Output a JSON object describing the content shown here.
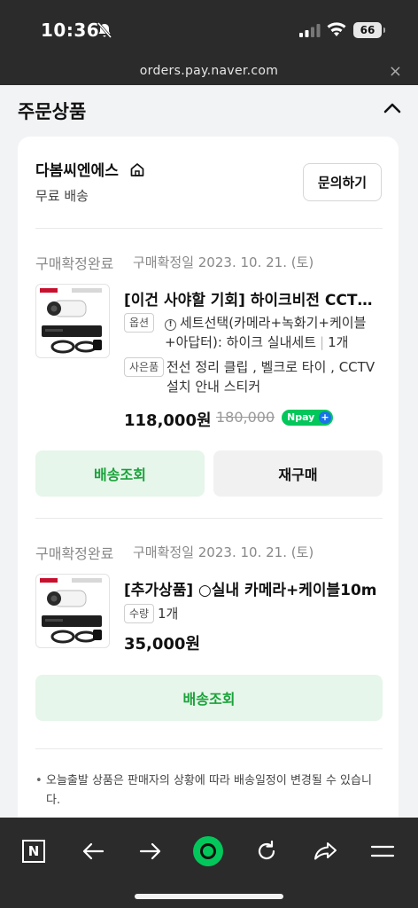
{
  "status_bar": {
    "time": "10:36",
    "battery": "66"
  },
  "browser": {
    "url": "orders.pay.naver.com",
    "close": "×"
  },
  "section": {
    "title": "주문상품"
  },
  "seller": {
    "name": "다봄씨엔에스",
    "shipping": "무료 배송",
    "inquiry_label": "문의하기"
  },
  "orders": [
    {
      "status": "구매확정완료",
      "date": "구매확정일 2023. 10. 21. (토)",
      "title": "[이건 사야할 기회] 하이크비전 CCTV 카메라 세트",
      "option_tag": "옵션",
      "option_text": "세트선택(카메라+녹화기+케이블+아답터): 하이크 실내세트",
      "option_qty": "1개",
      "gift_tag": "사은품",
      "gift_text": "전선 정리 클립 , 벨크로 타이 , CCTV 설치 안내 스티커",
      "price": "118,000원",
      "original_price": "180,000",
      "npay_badge": "Npay",
      "track_label": "배송조회",
      "rebuy_label": "재구매"
    },
    {
      "status": "구매확정완료",
      "date": "구매확정일 2023. 10. 21. (토)",
      "title": "[추가상품] ○실내 카메라+케이블10m",
      "qty_tag": "수량",
      "qty": "1개",
      "price": "35,000원",
      "track_label": "배송조회"
    }
  ],
  "notice": "오늘출발 상품은 판매자의 상황에 따라 배송일정이 변경될 수 있습니다.",
  "colors": {
    "green": "#1aa23a",
    "green_bg": "#e6f6ea",
    "dark": "#2b2b2b",
    "naver_green": "#03c75a"
  },
  "toolbar": {
    "icons": [
      "naver-n-icon",
      "back-arrow-icon",
      "forward-arrow-icon",
      "green-dot-icon",
      "refresh-icon",
      "share-icon",
      "menu-icon"
    ],
    "n_label": "N"
  }
}
